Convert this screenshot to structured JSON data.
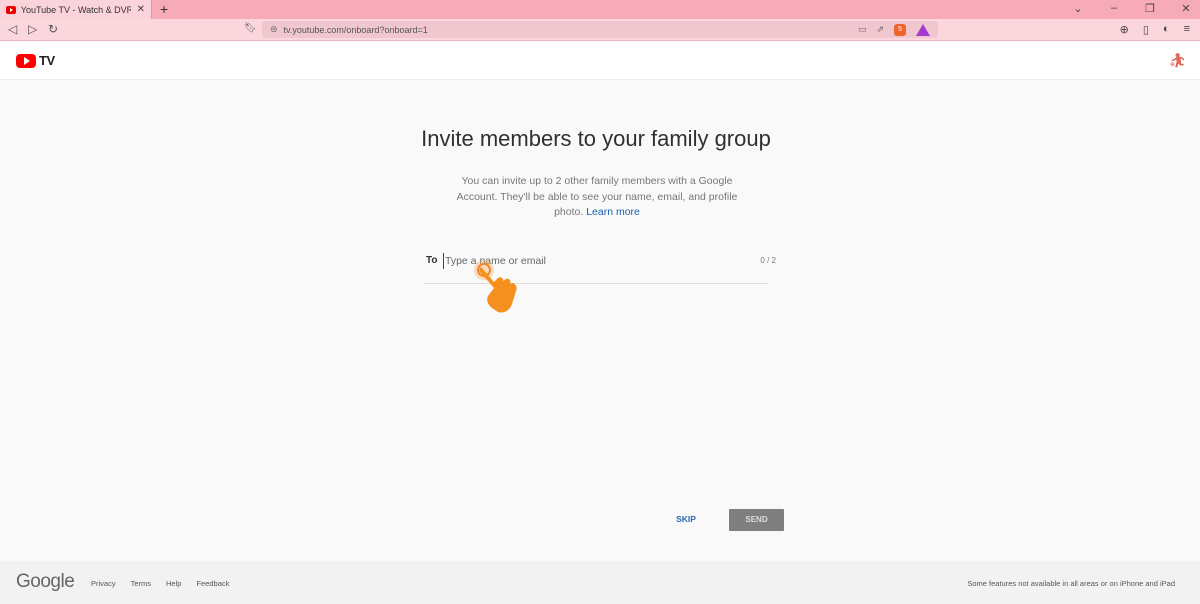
{
  "browser": {
    "tab_title": "YouTube TV - Watch & DVR Live S",
    "tab_close": "✕",
    "new_tab": "+",
    "url": "tv.youtube.com/onboard?onboard=1",
    "shield_count": "5"
  },
  "header": {
    "logo_text": "TV"
  },
  "main": {
    "title": "Invite members to your family group",
    "description": "You can invite up to 2 other family members with a Google Account. They'll be able to see your name, email, and profile photo.",
    "learn_more": "Learn more",
    "to_label": "To",
    "input_placeholder": "Type a name or email",
    "counter": "0 / 2"
  },
  "actions": {
    "skip": "SKIP",
    "send": "SEND"
  },
  "footer": {
    "google": "Google",
    "links": [
      "Privacy",
      "Terms",
      "Help",
      "Feedback"
    ],
    "note": "Some features not available in all areas or on iPhone and iPad"
  }
}
